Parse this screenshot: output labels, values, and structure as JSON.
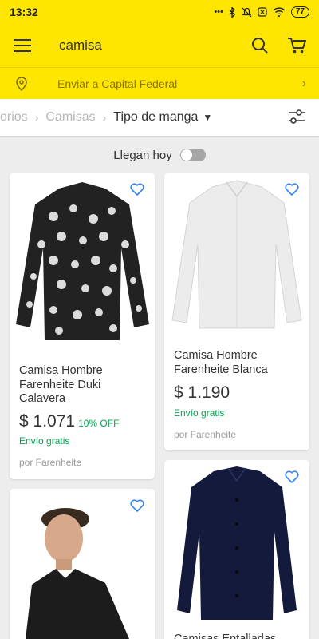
{
  "status_bar": {
    "time": "13:32",
    "dots": "•••",
    "battery": "77"
  },
  "header": {
    "query": "camisa",
    "menu_icon": "hamburger-icon",
    "search_icon": "search-icon",
    "cart_icon": "cart-icon"
  },
  "shipping": {
    "text": "Enviar a Capital Federal",
    "icon": "location-pin-icon"
  },
  "filters": {
    "crumb_1": "orios",
    "crumb_2": "Camisas",
    "active": "Tipo de manga"
  },
  "delivery_toggle": {
    "label": "Llegan hoy",
    "on": false
  },
  "products": [
    {
      "title": "Camisa Hombre Farenheite Duki Calavera",
      "price": "$ 1.071",
      "discount": "10% OFF",
      "shipping": "Envío gratis",
      "seller": "por Farenheite"
    },
    {
      "title": "Camisa Hombre Farenheite Blanca",
      "price": "$ 1.190",
      "shipping": "Envío gratis",
      "seller": "por Farenheite"
    },
    {
      "title": ""
    },
    {
      "title": "Camisas Entalladas"
    }
  ],
  "colors": {
    "brand_yellow": "#ffe600",
    "link_blue": "#3483fa",
    "green": "#00a650"
  }
}
